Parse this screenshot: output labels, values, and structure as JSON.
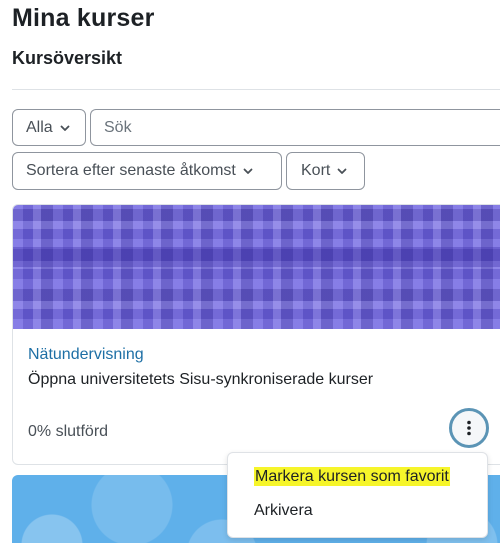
{
  "header": {
    "title": "Mina kurser",
    "section_title": "Kursöversikt"
  },
  "filters": {
    "grouping_label": "Alla",
    "search_placeholder": "Sök",
    "sort_label": "Sortera efter senaste åtkomst",
    "view_label": "Kort"
  },
  "courses": [
    {
      "category": "Nätundervisning",
      "name": "Öppna universitetets Sisu-synkroniserade kurser",
      "progress": "0% slutförd",
      "image_color": "#6a5fe0"
    },
    {
      "image_color": "#5fb0ea"
    }
  ],
  "course_menu": {
    "items": [
      {
        "label": "Markera kursen som favorit"
      },
      {
        "label": "Arkivera"
      }
    ]
  },
  "colors": {
    "link": "#1d6fa5",
    "focus_ring": "#5b94b5",
    "highlight": "#f6f52a"
  },
  "icons": {
    "dropdown_chevron": "chevron-down-icon",
    "course_actions": "more-vertical-icon"
  }
}
